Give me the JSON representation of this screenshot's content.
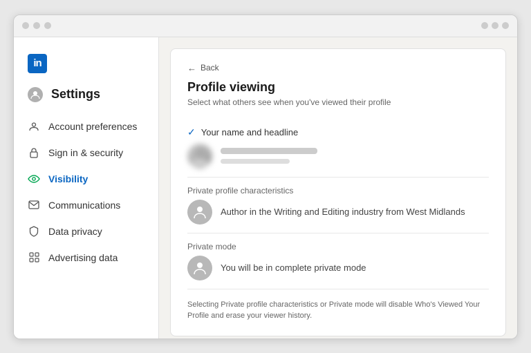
{
  "browser": {
    "dots": [
      "dot1",
      "dot2",
      "dot3"
    ],
    "controls": [
      "ctrl1",
      "ctrl2",
      "ctrl3"
    ]
  },
  "sidebar": {
    "logo_text": "in",
    "title": "Settings",
    "items": [
      {
        "id": "account-preferences",
        "label": "Account preferences",
        "icon": "person",
        "active": false
      },
      {
        "id": "sign-security",
        "label": "Sign in & security",
        "icon": "lock",
        "active": false
      },
      {
        "id": "visibility",
        "label": "Visibility",
        "icon": "eye",
        "active": true
      },
      {
        "id": "communications",
        "label": "Communications",
        "icon": "envelope",
        "active": false
      },
      {
        "id": "data-privacy",
        "label": "Data privacy",
        "icon": "shield",
        "active": false
      },
      {
        "id": "advertising-data",
        "label": "Advertising data",
        "icon": "grid",
        "active": false
      }
    ]
  },
  "main": {
    "back_label": "Back",
    "page_title": "Profile viewing",
    "page_subtitle": "Select what others see when you've viewed their profile",
    "options": [
      {
        "id": "your-name-headline",
        "label": "Your name and headline",
        "checked": true,
        "has_avatar": true,
        "avatar_blurred": true
      },
      {
        "id": "private-profile",
        "section_label": "Private profile characteristics",
        "description": "Author in the Writing and Editing industry from West Midlands",
        "has_avatar_icon": true
      },
      {
        "id": "private-mode",
        "section_label": "Private mode",
        "description": "You will be in complete private mode",
        "has_avatar_icon": true
      }
    ],
    "footer_note": "Selecting Private profile characteristics or Private mode will disable Who's Viewed Your Profile and erase your viewer history."
  }
}
